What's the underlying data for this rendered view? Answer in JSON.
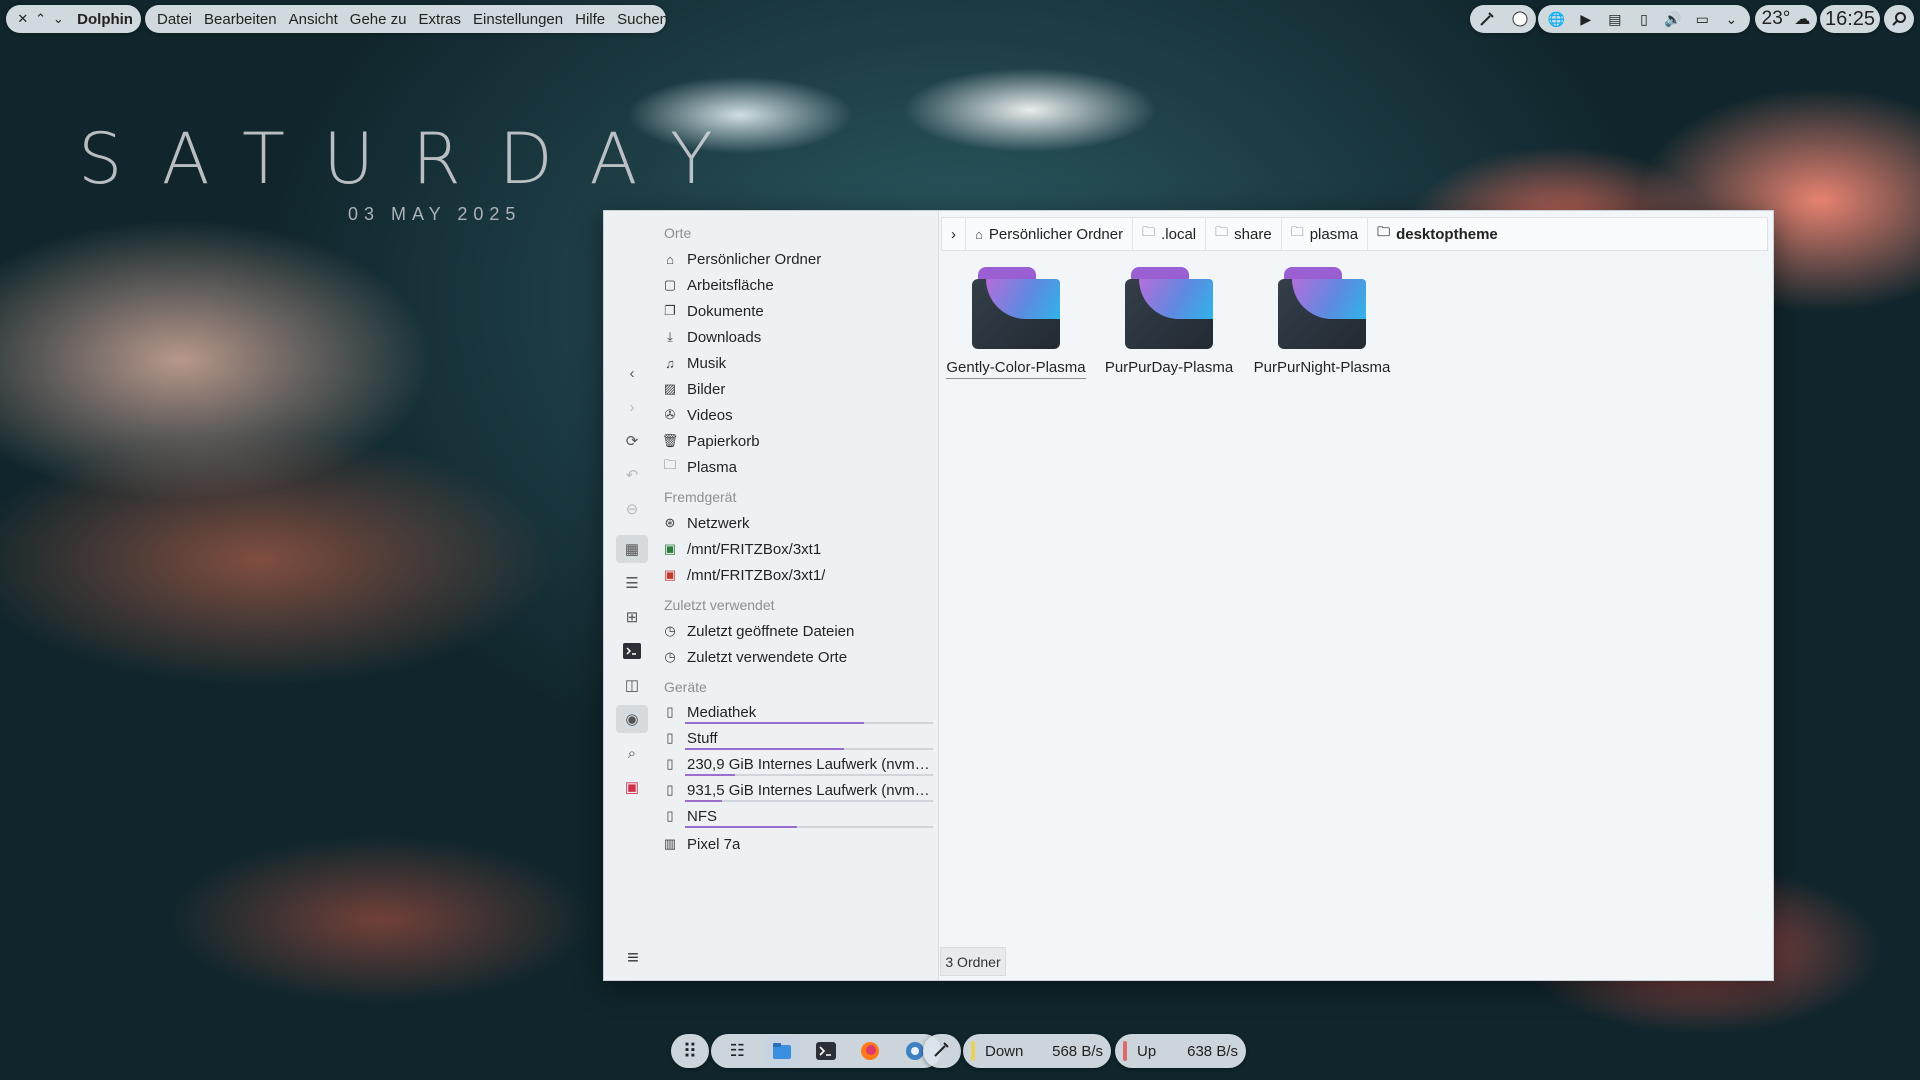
{
  "top_panel": {
    "window_controls": [
      "close-icon",
      "maximize-icon",
      "minimize-icon"
    ],
    "app_name": "Dolphin",
    "menu": [
      "Datei",
      "Bearbeiten",
      "Ansicht",
      "Gehe zu",
      "Extras",
      "Einstellungen",
      "Hilfe",
      "Suchen"
    ],
    "weather_temp": "23°",
    "clock": "16:25"
  },
  "widget": {
    "day": "SATURDAY",
    "date": "03 MAY 2025"
  },
  "places": {
    "sections": {
      "orte": "Orte",
      "fremdgeraet": "Fremdgerät",
      "zuletzt": "Zuletzt verwendet",
      "geraete": "Geräte"
    },
    "orte": [
      "Persönlicher Ordner",
      "Arbeitsfläche",
      "Dokumente",
      "Downloads",
      "Musik",
      "Bilder",
      "Videos",
      "Papierkorb",
      "Plasma"
    ],
    "remote": [
      "Netzwerk",
      "/mnt/FRITZBox/3xt1",
      "/mnt/FRITZBox/3xt1/"
    ],
    "recent": [
      "Zuletzt geöffnete Dateien",
      "Zuletzt verwendete Orte"
    ],
    "devices": [
      {
        "label": "Mediathek",
        "usage": 0.72
      },
      {
        "label": "Stuff",
        "usage": 0.64
      },
      {
        "label": "230,9 GiB Internes Laufwerk (nvme...",
        "usage": 0.2
      },
      {
        "label": "931,5 GiB Internes Laufwerk (nvme...",
        "usage": 0.15
      },
      {
        "label": "NFS",
        "usage": 0.45
      },
      {
        "label": "Pixel 7a",
        "usage": null
      }
    ]
  },
  "breadcrumb": [
    "Persönlicher Ordner",
    ".local",
    "share",
    "plasma",
    "desktoptheme"
  ],
  "folders": [
    "Gently-Color-Plasma",
    "PurPurDay-Plasma",
    "PurPurNight-Plasma"
  ],
  "status": "3 Ordner",
  "dock": {
    "down_label": "Down",
    "down_value": "568 B/s",
    "up_label": "Up",
    "up_value": "638 B/s"
  },
  "colors": {
    "accent": "#9b6fd0",
    "down_bar": "#e8d35a",
    "up_bar": "#e06a6a"
  }
}
